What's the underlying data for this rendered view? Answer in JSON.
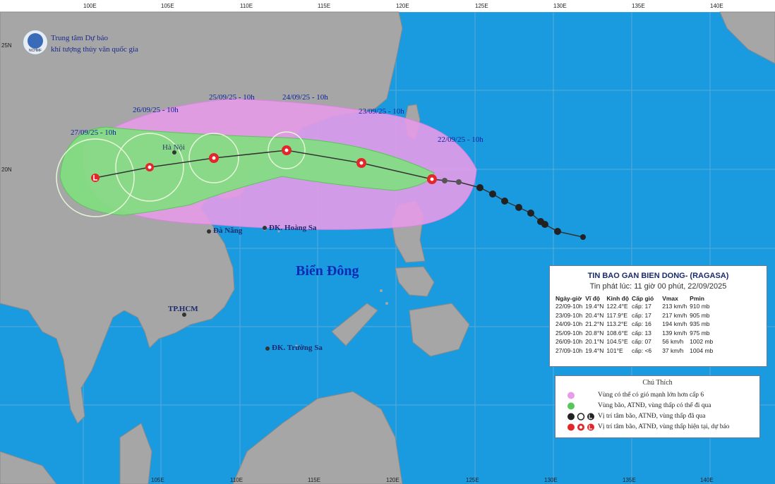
{
  "header": {
    "org_line1": "Trung tâm Dự báo",
    "org_line2": "khí tượng thủy văn quốc gia",
    "logo_text": "NCHMF"
  },
  "axes": {
    "top": [
      "100E",
      "105E",
      "110E",
      "115E",
      "120E",
      "125E",
      "130E",
      "135E",
      "140E"
    ],
    "bottom": [
      "105E",
      "110E",
      "115E",
      "120E",
      "125E",
      "130E",
      "135E",
      "140E"
    ],
    "left": [
      "25N",
      "20N"
    ]
  },
  "forecast_labels": [
    "27/09/25 - 10h",
    "26/09/25 - 10h",
    "25/09/25 - 10h",
    "24/09/25 - 10h",
    "23/09/25 - 10h",
    "22/09/25 - 10h"
  ],
  "places": {
    "hanoi": "Hà Nội",
    "danang": "Đà Nẵng",
    "hoangsa": "ĐK. Hoàng Sa",
    "hcm": "TP.HCM",
    "truongsa": "ĐK. Trường Sa",
    "sea": "Biển Đông"
  },
  "info": {
    "title": "TIN BAO GAN BIEN DONG- (RAGASA)",
    "issued": "Tin phát lúc: 11 giờ 00 phút, 22/09/2025",
    "headers": [
      "Ngày-giờ",
      "Vĩ độ",
      "Kinh độ",
      "Cấp gió",
      "Vmax",
      "Pmin"
    ],
    "rows": [
      [
        "22/09-10h",
        "19.4°N",
        "122.4°E",
        "cấp: 17",
        "213 km/h",
        "910 mb"
      ],
      [
        "23/09-10h",
        "20.4°N",
        "117.9°E",
        "cấp: 17",
        "217 km/h",
        "905 mb"
      ],
      [
        "24/09-10h",
        "21.2°N",
        "113.2°E",
        "cấp: 16",
        "194 km/h",
        "935 mb"
      ],
      [
        "25/09-10h",
        "20.8°N",
        "108.6°E",
        "cấp: 13",
        "139 km/h",
        "975 mb"
      ],
      [
        "26/09-10h",
        "20.1°N",
        "104.5°E",
        "cấp: 07",
        "56 km/h",
        "1002 mb"
      ],
      [
        "27/09-10h",
        "19.4°N",
        "101°E",
        "cấp: <6",
        "37 km/h",
        "1004 mb"
      ]
    ]
  },
  "legend": {
    "title": "Chú Thích",
    "items": [
      "Vùng có thể có gió mạnh lớn hơn cấp 6",
      "Vùng bão, ATNĐ, vùng thấp có thể đi qua",
      "Vị trí tâm bão, ATNĐ, vùng thấp đã qua",
      "Vị trí tâm bão, ATNĐ, vùng thấp hiện tại, dự báo"
    ]
  },
  "colors": {
    "sea": "#1a9be0",
    "land": "#a6a6a6",
    "strong_wind_zone": "#e7a3e8",
    "storm_zone": "#7fe07f",
    "track": "#333333",
    "current_forecast_icon": "#e2262a"
  }
}
